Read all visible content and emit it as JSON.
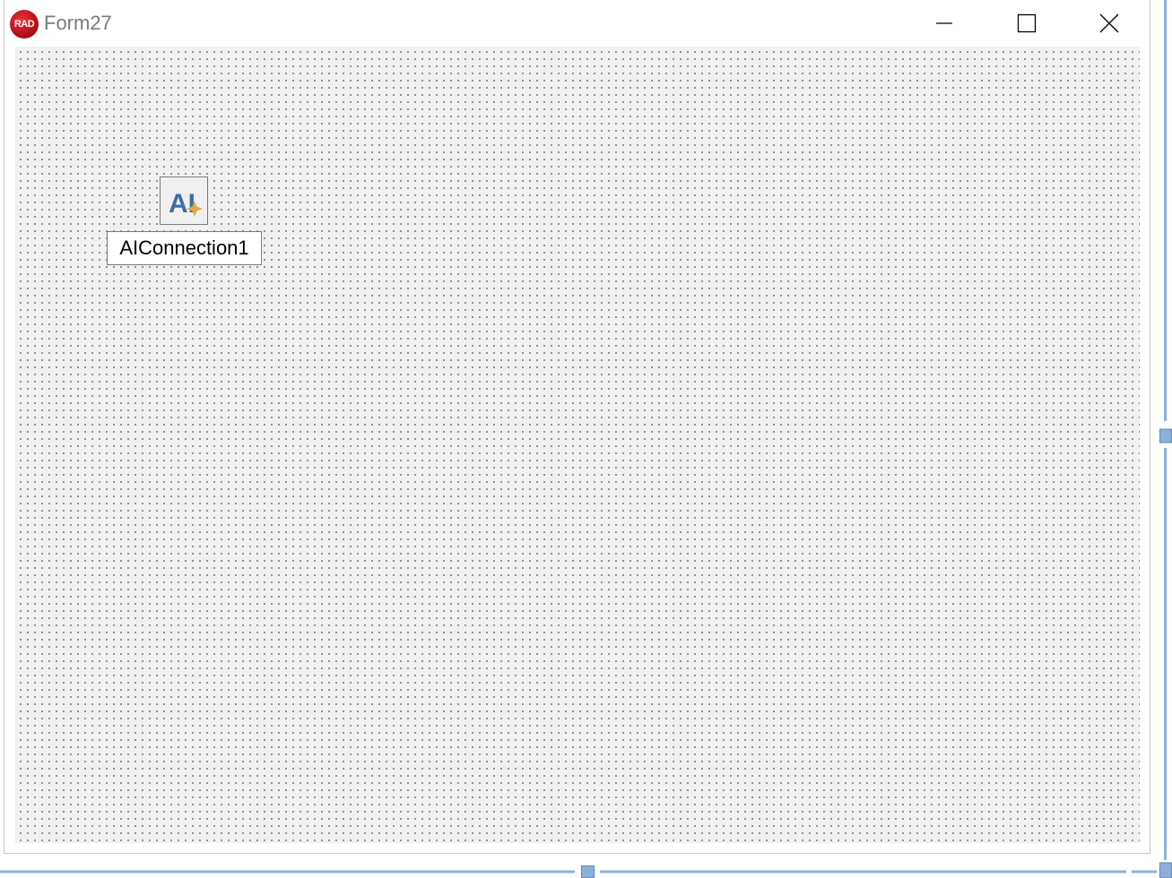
{
  "window": {
    "title": "Form27",
    "logo_text": "RAD"
  },
  "caption_buttons": {
    "minimize": "minimize-icon",
    "maximize": "maximize-icon",
    "close": "close-icon"
  },
  "component": {
    "name": "AIConnection1",
    "icon_text": "AI",
    "icon": "ai-connection-icon"
  },
  "colors": {
    "logo_red": "#c0141c",
    "icon_blue": "#3d6ea8",
    "icon_sparkle": "#e8a640",
    "surface": "#f0f0f0",
    "splitter": "#8cb0d8"
  }
}
